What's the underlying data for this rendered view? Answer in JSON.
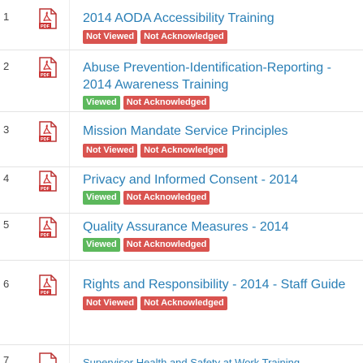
{
  "items": [
    {
      "num": "1",
      "title": "2014 AODA Accessibility Training",
      "status1": "Not Viewed",
      "status1_color": "#d9534f",
      "status2": "Not Acknowledged"
    },
    {
      "num": "2",
      "title": "Abuse Prevention-Identification-Reporting - 2014 Awareness Training",
      "status1": "Viewed",
      "status1_color": "#5cb85c",
      "status2": "Not Acknowledged"
    },
    {
      "num": "3",
      "title": "Mission Mandate Service Principles",
      "status1": "Not Viewed",
      "status1_color": "#d9534f",
      "status2": "Not Acknowledged"
    },
    {
      "num": "4",
      "title": "Privacy and Informed Consent - 2014",
      "status1": "Viewed",
      "status1_color": "#5cb85c",
      "status2": "Not Acknowledged"
    },
    {
      "num": "5",
      "title": "Quality Assurance Measures - 2014",
      "status1": "Viewed",
      "status1_color": "#5cb85c",
      "status2": "Not Acknowledged"
    },
    {
      "num": "6",
      "title": "Rights and Responsibility - 2014 - Staff Guide",
      "status1": "Not Viewed",
      "status1_color": "#d9534f",
      "status2": "Not Acknowledged"
    },
    {
      "num": "7",
      "title": "Supervisor Health and Safety at Work Training"
    }
  ],
  "icons": {
    "file": "pdf-file-icon",
    "label": "PDF"
  },
  "colors": {
    "link": "#2a7fb6",
    "not_viewed": "#d9534f",
    "viewed": "#5cb85c",
    "not_acknowledged": "#d9534f"
  }
}
